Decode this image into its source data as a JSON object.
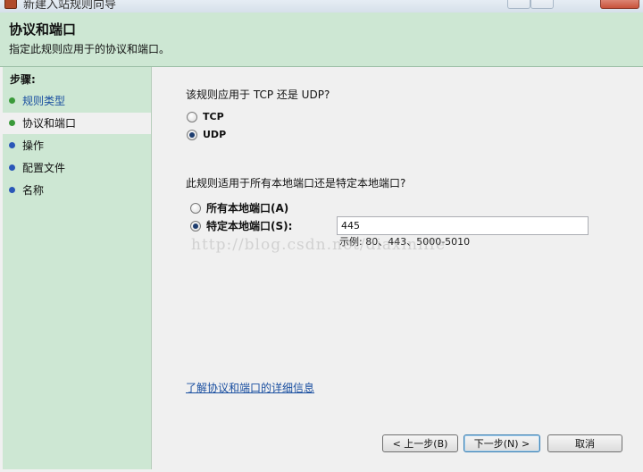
{
  "window": {
    "title": "新建入站规则向导"
  },
  "header": {
    "title": "协议和端口",
    "subtitle": "指定此规则应用于的协议和端口。"
  },
  "steps": {
    "title": "步骤:",
    "items": [
      {
        "label": "规则类型",
        "state": "done"
      },
      {
        "label": "协议和端口",
        "state": "current"
      },
      {
        "label": "操作",
        "state": "pending"
      },
      {
        "label": "配置文件",
        "state": "pending"
      },
      {
        "label": "名称",
        "state": "pending"
      }
    ]
  },
  "protocol": {
    "question": "该规则应用于 TCP 还是 UDP?",
    "options": [
      {
        "label": "TCP",
        "selected": false
      },
      {
        "label": "UDP",
        "selected": true
      }
    ]
  },
  "ports": {
    "question": "此规则适用于所有本地端口还是特定本地端口?",
    "options": [
      {
        "label": "所有本地端口(A)",
        "selected": false
      },
      {
        "label": "特定本地端口(S):",
        "selected": true
      }
    ],
    "value": "445",
    "example": "示例: 80、443、5000-5010"
  },
  "watermark": "http://blog.csdn.net/diaxinlife",
  "link": {
    "label": "了解协议和端口的详细信息"
  },
  "buttons": {
    "back": "< 上一步(B)",
    "next": "下一步(N) >",
    "cancel": "取消"
  },
  "colors": {
    "header_bg": "#cde7d3",
    "link": "#1a4fa0"
  }
}
